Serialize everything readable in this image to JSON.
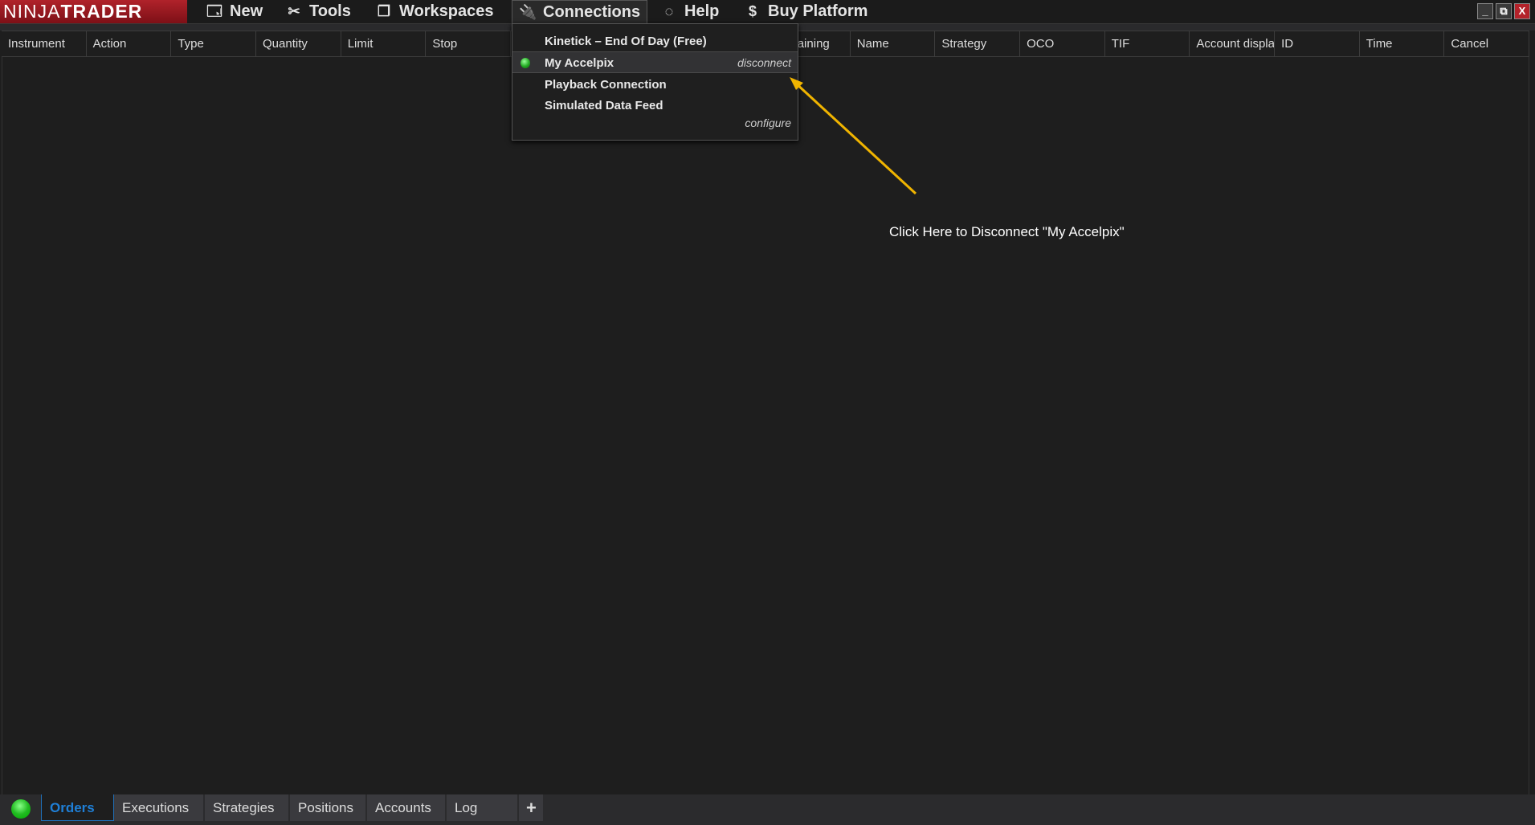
{
  "app": {
    "logo_light": "NINJA",
    "logo_bold": "TRADER"
  },
  "menu": {
    "new": "New",
    "tools": "Tools",
    "workspaces": "Workspaces",
    "connections": "Connections",
    "help": "Help",
    "buy": "Buy Platform"
  },
  "window_buttons": {
    "minimize": "_",
    "restore": "⧉",
    "close": "X"
  },
  "columns": [
    "Instrument",
    "Action",
    "Type",
    "Quantity",
    "Limit",
    "Stop",
    "",
    "",
    "",
    "Remaining",
    "Name",
    "Strategy",
    "OCO",
    "TIF",
    "Account displa",
    "ID",
    "Time",
    "Cancel"
  ],
  "connections_menu": {
    "items": [
      {
        "label": "Kinetick – End Of Day (Free)"
      },
      {
        "label": "My Accelpix",
        "connected": true,
        "action": "disconnect"
      },
      {
        "label": "Playback Connection"
      },
      {
        "label": "Simulated Data Feed"
      }
    ],
    "configure": "configure"
  },
  "annotation": "Click Here to Disconnect \"My Accelpix\"",
  "tabs": [
    "Orders",
    "Executions",
    "Strategies",
    "Positions",
    "Accounts",
    "Log"
  ],
  "add_tab": "+",
  "colors": {
    "accent": "#1f7fd6",
    "logo": "#b0222a",
    "arrow": "#f0b400",
    "connected": "#22aa22"
  }
}
